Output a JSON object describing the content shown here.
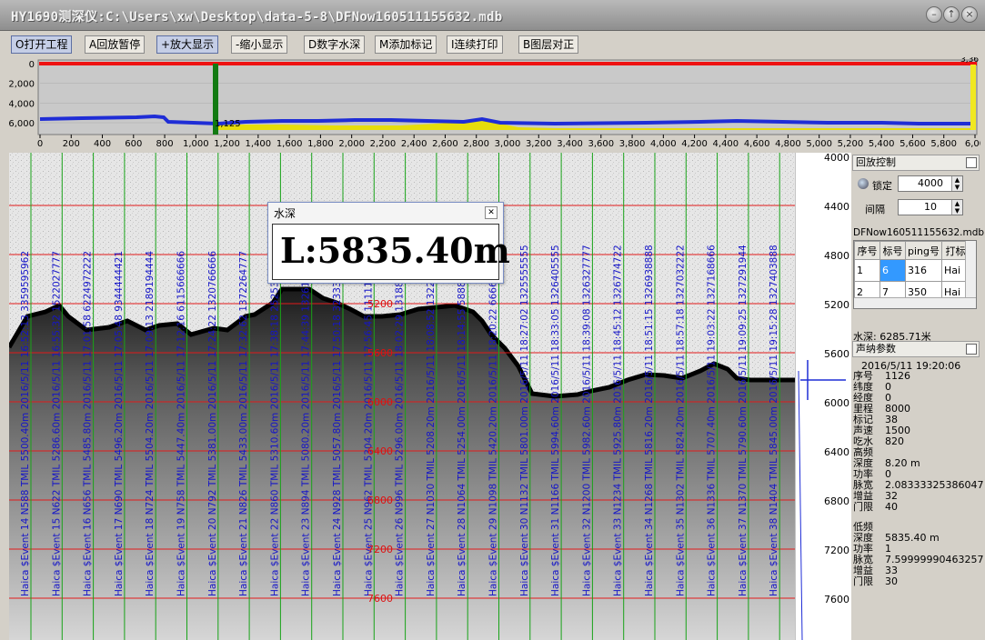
{
  "window": {
    "title": "HY1690测深仪:C:\\Users\\xw\\Desktop\\data-5-8\\DFNow160511155632.mdb"
  },
  "toolbar": [
    {
      "label": "O打开工程",
      "active": true
    },
    {
      "label": "A回放暂停",
      "active": false
    },
    {
      "label": "+放大显示",
      "active": true
    },
    {
      "label": "-缩小显示",
      "active": false
    },
    {
      "label": "D数字水深",
      "active": false
    },
    {
      "label": "M添加标记",
      "active": false
    },
    {
      "label": "I连续打印",
      "active": false
    },
    {
      "label": "B图层对正",
      "active": false
    }
  ],
  "overview": {
    "y_ticks": [
      "0",
      "2,000",
      "4,000",
      "6,000"
    ],
    "x_ticks": [
      "0",
      "200",
      "400",
      "600",
      "800",
      "1,000",
      "1,200",
      "1,400",
      "1,600",
      "1,800",
      "2,000",
      "2,200",
      "2,400",
      "2,600",
      "2,800",
      "3,000",
      "3,200",
      "3,400",
      "3,600",
      "3,800",
      "4,000",
      "4,200",
      "4,400",
      "4,600",
      "4,800",
      "5,000",
      "5,200",
      "5,400",
      "5,600",
      "5,800",
      "6,00"
    ],
    "cursor_label": "1,125",
    "corner_label": "3,36"
  },
  "echogram": {
    "depth_ticks": [
      "4400",
      "4800",
      "5200",
      "5600",
      "6000",
      "6400",
      "6800",
      "7200",
      "7600"
    ],
    "right_axis_ticks": [
      "4000",
      "4400",
      "4800",
      "5200",
      "5600",
      "6000",
      "6400",
      "6800",
      "7200",
      "7600"
    ],
    "event_labels": [
      "Haica $Event 14 N588 TMIL 5500.40m 2016/5/11 16:52:13 3359595962",
      "Haica $Event 15 N622 TMIL 5286.60m 2016/5/11 16:55:32 1522027777",
      "Haica $Event 16 N656 TMIL 5485.80m 2016/5/11 17:01:58 6224972222",
      "Haica $Event 17 N690 TMIL 5496.20m 2016/5/11 17:05:48 9344444421",
      "Haica $Event 18 N724 TMIL 5504.20m 2016/5/11 17:09:13 2189194444",
      "Haica $Event 19 N758 TMIL 5447.40m 2016/5/11 17:12:16 6115666666",
      "Haica $Event 20 N792 TMIL 5381.00m 2016/5/11 17:24:22 1320766666",
      "Haica $Event 21 N826 TMIL 5433.00m 2016/5/11 17:32:62 1372264777",
      "Haica $Event 22 N860 TMIL 5310.60m 2016/5/11 17:38:18 2525386019",
      "Haica $Event 23 N894 TMIL 5080.20m 2016/5/11 17:44:39 1326148777",
      "Haica $Event 24 N928 TMIL 5057.80m 2016/5/11 17:50:18 3233333333",
      "Haica $Event 25 N962 TMIL 5304.20m 2016/5/11 17:56:45 1111111111",
      "Haica $Event 26 N996 TMIL 5296.00m 2016/5/11 18:02:29 1318888889",
      "Haica $Event 27 N1030 TMIL 5208.20m 2016/5/11 18:08:52 1322222222",
      "Haica $Event 28 N1064 TMIL 5254.00m 2016/5/11 18:14:55 5888888889",
      "Haica $Event 29 N1098 TMIL 5420.20m 2016/5/11 18:20:22 6666666667",
      "Haica $Event 30 N1132 TMIL 5801.00m 2016/5/11 18:27:02 1325555555",
      "Haica $Event 31 N1166 TMIL 5994.60m 2016/5/11 18:33:05 1326405555",
      "Haica $Event 32 N1200 TMIL 5982.60m 2016/5/11 18:39:08 1326327777",
      "Haica $Event 33 N1234 TMIL 5925.80m 2016/5/11 18:45:12 1326774722",
      "Haica $Event 34 N1268 TMIL 5816.20m 2016/5/11 18:51:15 1326938888",
      "Haica $Event 35 N1302 TMIL 5824.20m 2016/5/11 18:57:18 1327032222",
      "Haica $Event 36 N1336 TMIL 5707.40m 2016/5/11 19:03:22 1327168666",
      "Haica $Event 37 N1370 TMIL 5790.60m 2016/5/11 19:09:25 1327291944",
      "Haica $Event 38 N1404 TMIL 5845.00m 2016/5/11 19:15:28 1327403888"
    ]
  },
  "popup": {
    "title": "水深",
    "value": "L:5835.40m"
  },
  "panel": {
    "replay_header": "回放控制",
    "lock_label": "锁定",
    "lock_value": "4000",
    "interval_label": "间隔",
    "interval_value": "10",
    "file_name": "DFNow160511155632.mdb",
    "table_headers": [
      "序号",
      "标号",
      "ping号",
      "打标"
    ],
    "table_rows": [
      [
        "1",
        "6",
        "316",
        "Hai"
      ],
      [
        "2",
        "7",
        "350",
        "Hai"
      ]
    ],
    "depth_readout": "水深: 6285.71米",
    "sonar_header": "声纳参数",
    "datetime": "2016/5/11 19:20:06",
    "params": [
      {
        "label": "序号",
        "value": "1126"
      },
      {
        "label": "纬度",
        "value": "0"
      },
      {
        "label": "经度",
        "value": "0"
      },
      {
        "label": "里程",
        "value": "8000"
      },
      {
        "label": "标记",
        "value": "38"
      },
      {
        "label": "声速",
        "value": "1500"
      },
      {
        "label": "吃水",
        "value": "820"
      }
    ],
    "high_freq_title": "高频",
    "high_freq": [
      {
        "label": "深度",
        "value": "8.20 m"
      },
      {
        "label": "功率",
        "value": "0"
      },
      {
        "label": "脉宽",
        "value": "2.08333325386047"
      },
      {
        "label": "增益",
        "value": "32"
      },
      {
        "label": "门限",
        "value": "40"
      }
    ],
    "low_freq_title": "低频",
    "low_freq": [
      {
        "label": "深度",
        "value": "5835.40 m"
      },
      {
        "label": "功率",
        "value": "1"
      },
      {
        "label": "脉宽",
        "value": "7.59999990463257"
      },
      {
        "label": "增益",
        "value": "33"
      },
      {
        "label": "门限",
        "value": "30"
      }
    ]
  },
  "colors": {
    "bottom_line": "#1f2dd6",
    "surface_line": "#ee1111",
    "cursor": "#127a12",
    "event_text": "#1515c8",
    "grid_red": "#e21a1a",
    "grid_green": "#18a318"
  }
}
